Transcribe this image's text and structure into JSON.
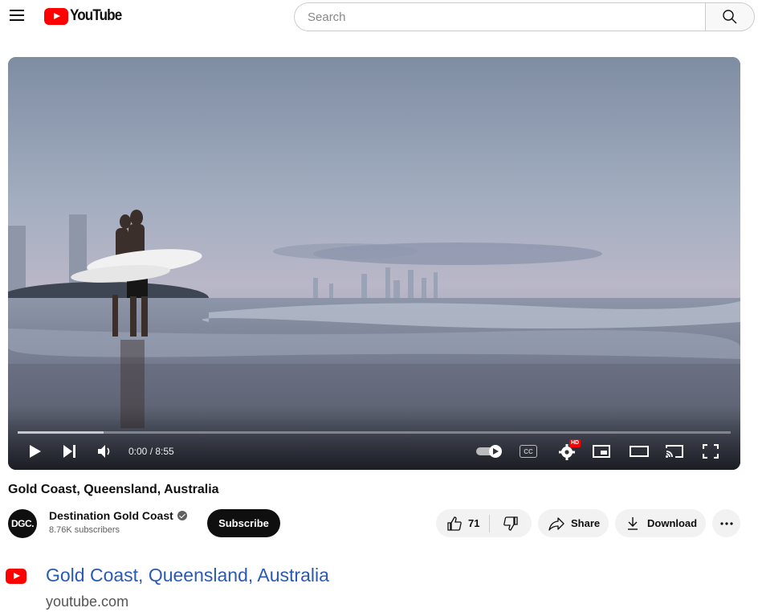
{
  "header": {
    "logo_text": "YouTube",
    "search_placeholder": "Search"
  },
  "player": {
    "time_display": "0:00 / 8:55",
    "buffered_fraction": 0.12,
    "hd_badge": "HD",
    "cc_label": "CC"
  },
  "video": {
    "title": "Gold Coast, Queensland, Australia"
  },
  "channel": {
    "avatar_text": "DGC.",
    "name": "Destination Gold Coast",
    "subscribers": "8.76K subscribers",
    "subscribe_label": "Subscribe"
  },
  "actions": {
    "like_count": "71",
    "share_label": "Share",
    "download_label": "Download"
  },
  "link_card": {
    "title": "Gold Coast, Queensland, Australia",
    "domain": "youtube.com"
  },
  "colors": {
    "brand_red": "#ff0000",
    "link_blue": "#2a5ab5"
  }
}
